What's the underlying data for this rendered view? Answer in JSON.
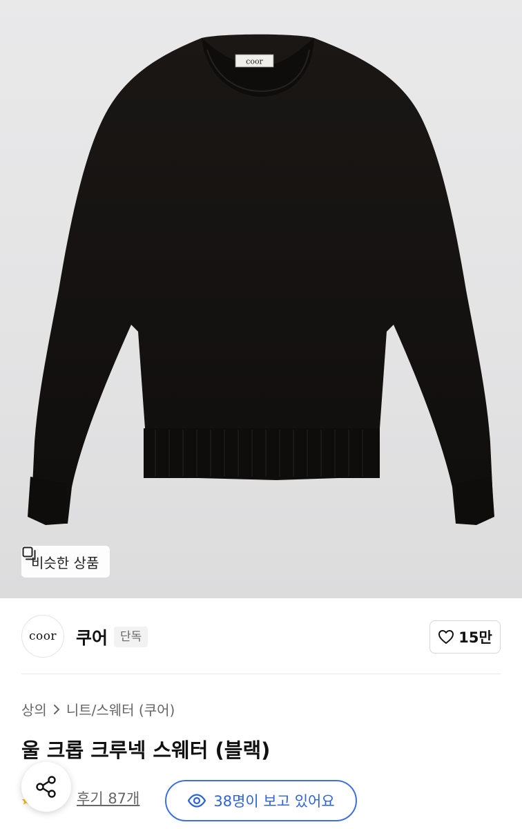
{
  "hero": {
    "product_label_text": "coor",
    "similar_button_label": "비슷한 상품"
  },
  "brand": {
    "logo_text": "coor",
    "name": "쿠어",
    "badge": "단독",
    "like_count": "15만"
  },
  "breadcrumb": {
    "items": [
      "상의",
      "니트/스웨터 (쿠어)"
    ]
  },
  "product": {
    "title": "울 크롭 크루넥 스웨터 (블랙)"
  },
  "reviews": {
    "label": "후기 87개"
  },
  "viewers": {
    "label": "38명이 보고 있어요"
  },
  "icons": {
    "similar": "copy-icon",
    "like": "heart-icon",
    "breadcrumb_separator": "chevron-right-icon",
    "share": "share-icon",
    "viewers": "eye-icon",
    "rating": "star-icon"
  },
  "colors": {
    "accent_blue": "#3b6fe0",
    "text_primary": "#111111",
    "text_secondary": "#666666",
    "hero_background": "#e5e5e6",
    "sweater": "#141211"
  }
}
